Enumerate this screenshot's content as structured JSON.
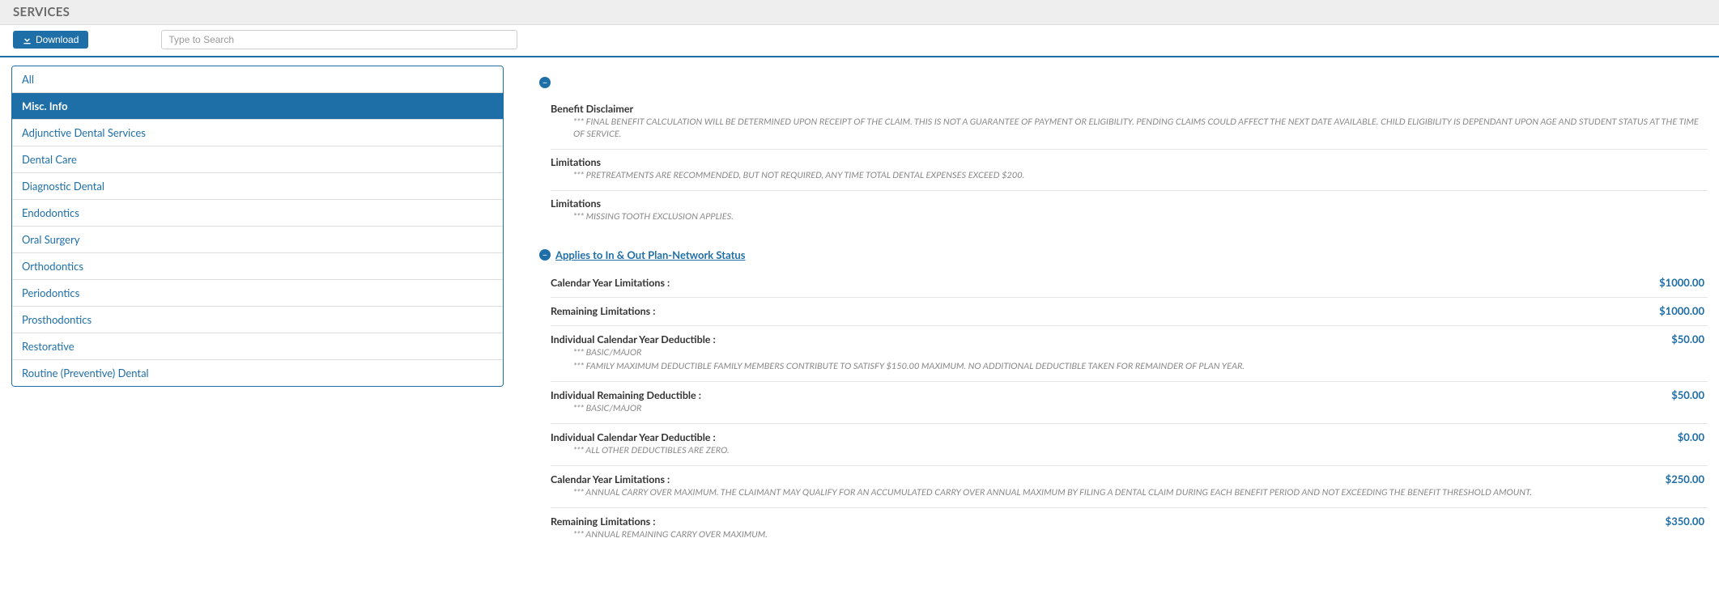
{
  "header": {
    "title": "SERVICES"
  },
  "toolbar": {
    "download_label": "Download",
    "search_placeholder": "Type to Search"
  },
  "sidebar": {
    "items": [
      {
        "label": "All",
        "active": false
      },
      {
        "label": "Misc. Info",
        "active": true
      },
      {
        "label": "Adjunctive Dental Services",
        "active": false
      },
      {
        "label": "Dental Care",
        "active": false
      },
      {
        "label": "Diagnostic Dental",
        "active": false
      },
      {
        "label": "Endodontics",
        "active": false
      },
      {
        "label": "Oral Surgery",
        "active": false
      },
      {
        "label": "Orthodontics",
        "active": false
      },
      {
        "label": "Periodontics",
        "active": false
      },
      {
        "label": "Prosthodontics",
        "active": false
      },
      {
        "label": "Restorative",
        "active": false
      },
      {
        "label": "Routine (Preventive) Dental",
        "active": false
      }
    ]
  },
  "main": {
    "section1": {
      "items": [
        {
          "label": "Benefit Disclaimer",
          "note": "*** FINAL BENEFIT CALCULATION WILL BE DETERMINED UPON RECEIPT OF THE CLAIM. THIS IS NOT A GUARANTEE OF PAYMENT OR ELIGIBILITY. PENDING CLAIMS COULD AFFECT THE NEXT DATE AVAILABLE. CHILD ELIGIBILITY IS DEPENDANT UPON AGE AND STUDENT STATUS AT THE TIME OF SERVICE."
        },
        {
          "label": "Limitations",
          "note": "*** PRETREATMENTS ARE RECOMMENDED, BUT NOT REQUIRED, ANY TIME TOTAL DENTAL EXPENSES EXCEED $200."
        },
        {
          "label": "Limitations",
          "note": "*** MISSING TOOTH EXCLUSION APPLIES."
        }
      ]
    },
    "section2": {
      "title": "Applies to In & Out Plan-Network Status",
      "items": [
        {
          "label": "Calendar Year Limitations :",
          "value": "$1000.00"
        },
        {
          "label": "Remaining Limitations :",
          "value": "$1000.00"
        },
        {
          "label": "Individual Calendar Year Deductible :",
          "value": "$50.00",
          "note1": "*** BASIC/MAJOR",
          "note2": "*** FAMILY MAXIMUM DEDUCTIBLE FAMILY MEMBERS CONTRIBUTE TO SATISFY $150.00 MAXIMUM. NO ADDITIONAL DEDUCTIBLE TAKEN FOR REMAINDER OF PLAN YEAR."
        },
        {
          "label": "Individual Remaining Deductible :",
          "value": "$50.00",
          "note1": "*** BASIC/MAJOR"
        },
        {
          "label": "Individual Calendar Year Deductible :",
          "value": "$0.00",
          "note1": "*** ALL OTHER DEDUCTIBLES ARE ZERO."
        },
        {
          "label": "Calendar Year Limitations :",
          "value": "$250.00",
          "note1": "*** ANNUAL CARRY OVER MAXIMUM. THE CLAIMANT MAY QUALIFY FOR AN ACCUMULATED CARRY OVER ANNUAL MAXIMUM BY FILING A DENTAL CLAIM DURING EACH BENEFIT PERIOD AND NOT EXCEEDING THE BENEFIT THRESHOLD AMOUNT."
        },
        {
          "label": "Remaining Limitations :",
          "value": "$350.00",
          "note1": "*** ANNUAL REMAINING CARRY OVER MAXIMUM."
        }
      ]
    }
  }
}
